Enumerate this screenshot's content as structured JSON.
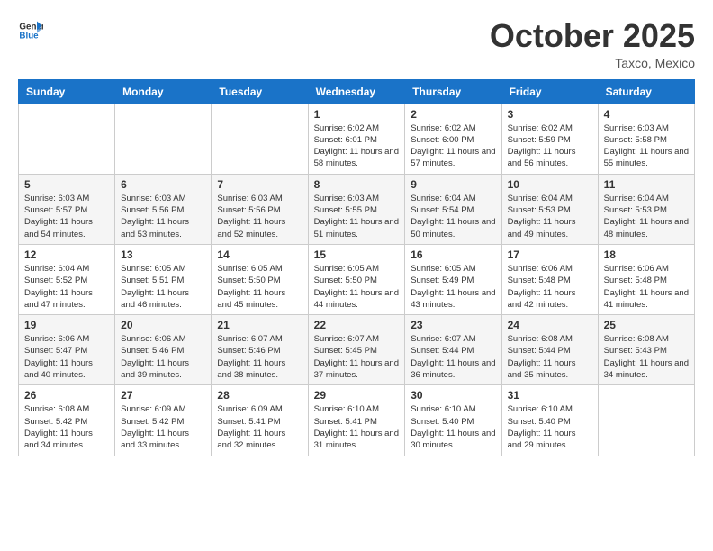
{
  "header": {
    "logo_line1": "General",
    "logo_line2": "Blue",
    "month": "October 2025",
    "location": "Taxco, Mexico"
  },
  "weekdays": [
    "Sunday",
    "Monday",
    "Tuesday",
    "Wednesday",
    "Thursday",
    "Friday",
    "Saturday"
  ],
  "weeks": [
    [
      {
        "day": "",
        "info": ""
      },
      {
        "day": "",
        "info": ""
      },
      {
        "day": "",
        "info": ""
      },
      {
        "day": "1",
        "info": "Sunrise: 6:02 AM\nSunset: 6:01 PM\nDaylight: 11 hours and 58 minutes."
      },
      {
        "day": "2",
        "info": "Sunrise: 6:02 AM\nSunset: 6:00 PM\nDaylight: 11 hours and 57 minutes."
      },
      {
        "day": "3",
        "info": "Sunrise: 6:02 AM\nSunset: 5:59 PM\nDaylight: 11 hours and 56 minutes."
      },
      {
        "day": "4",
        "info": "Sunrise: 6:03 AM\nSunset: 5:58 PM\nDaylight: 11 hours and 55 minutes."
      }
    ],
    [
      {
        "day": "5",
        "info": "Sunrise: 6:03 AM\nSunset: 5:57 PM\nDaylight: 11 hours and 54 minutes."
      },
      {
        "day": "6",
        "info": "Sunrise: 6:03 AM\nSunset: 5:56 PM\nDaylight: 11 hours and 53 minutes."
      },
      {
        "day": "7",
        "info": "Sunrise: 6:03 AM\nSunset: 5:56 PM\nDaylight: 11 hours and 52 minutes."
      },
      {
        "day": "8",
        "info": "Sunrise: 6:03 AM\nSunset: 5:55 PM\nDaylight: 11 hours and 51 minutes."
      },
      {
        "day": "9",
        "info": "Sunrise: 6:04 AM\nSunset: 5:54 PM\nDaylight: 11 hours and 50 minutes."
      },
      {
        "day": "10",
        "info": "Sunrise: 6:04 AM\nSunset: 5:53 PM\nDaylight: 11 hours and 49 minutes."
      },
      {
        "day": "11",
        "info": "Sunrise: 6:04 AM\nSunset: 5:53 PM\nDaylight: 11 hours and 48 minutes."
      }
    ],
    [
      {
        "day": "12",
        "info": "Sunrise: 6:04 AM\nSunset: 5:52 PM\nDaylight: 11 hours and 47 minutes."
      },
      {
        "day": "13",
        "info": "Sunrise: 6:05 AM\nSunset: 5:51 PM\nDaylight: 11 hours and 46 minutes."
      },
      {
        "day": "14",
        "info": "Sunrise: 6:05 AM\nSunset: 5:50 PM\nDaylight: 11 hours and 45 minutes."
      },
      {
        "day": "15",
        "info": "Sunrise: 6:05 AM\nSunset: 5:50 PM\nDaylight: 11 hours and 44 minutes."
      },
      {
        "day": "16",
        "info": "Sunrise: 6:05 AM\nSunset: 5:49 PM\nDaylight: 11 hours and 43 minutes."
      },
      {
        "day": "17",
        "info": "Sunrise: 6:06 AM\nSunset: 5:48 PM\nDaylight: 11 hours and 42 minutes."
      },
      {
        "day": "18",
        "info": "Sunrise: 6:06 AM\nSunset: 5:48 PM\nDaylight: 11 hours and 41 minutes."
      }
    ],
    [
      {
        "day": "19",
        "info": "Sunrise: 6:06 AM\nSunset: 5:47 PM\nDaylight: 11 hours and 40 minutes."
      },
      {
        "day": "20",
        "info": "Sunrise: 6:06 AM\nSunset: 5:46 PM\nDaylight: 11 hours and 39 minutes."
      },
      {
        "day": "21",
        "info": "Sunrise: 6:07 AM\nSunset: 5:46 PM\nDaylight: 11 hours and 38 minutes."
      },
      {
        "day": "22",
        "info": "Sunrise: 6:07 AM\nSunset: 5:45 PM\nDaylight: 11 hours and 37 minutes."
      },
      {
        "day": "23",
        "info": "Sunrise: 6:07 AM\nSunset: 5:44 PM\nDaylight: 11 hours and 36 minutes."
      },
      {
        "day": "24",
        "info": "Sunrise: 6:08 AM\nSunset: 5:44 PM\nDaylight: 11 hours and 35 minutes."
      },
      {
        "day": "25",
        "info": "Sunrise: 6:08 AM\nSunset: 5:43 PM\nDaylight: 11 hours and 34 minutes."
      }
    ],
    [
      {
        "day": "26",
        "info": "Sunrise: 6:08 AM\nSunset: 5:42 PM\nDaylight: 11 hours and 34 minutes."
      },
      {
        "day": "27",
        "info": "Sunrise: 6:09 AM\nSunset: 5:42 PM\nDaylight: 11 hours and 33 minutes."
      },
      {
        "day": "28",
        "info": "Sunrise: 6:09 AM\nSunset: 5:41 PM\nDaylight: 11 hours and 32 minutes."
      },
      {
        "day": "29",
        "info": "Sunrise: 6:10 AM\nSunset: 5:41 PM\nDaylight: 11 hours and 31 minutes."
      },
      {
        "day": "30",
        "info": "Sunrise: 6:10 AM\nSunset: 5:40 PM\nDaylight: 11 hours and 30 minutes."
      },
      {
        "day": "31",
        "info": "Sunrise: 6:10 AM\nSunset: 5:40 PM\nDaylight: 11 hours and 29 minutes."
      },
      {
        "day": "",
        "info": ""
      }
    ]
  ]
}
